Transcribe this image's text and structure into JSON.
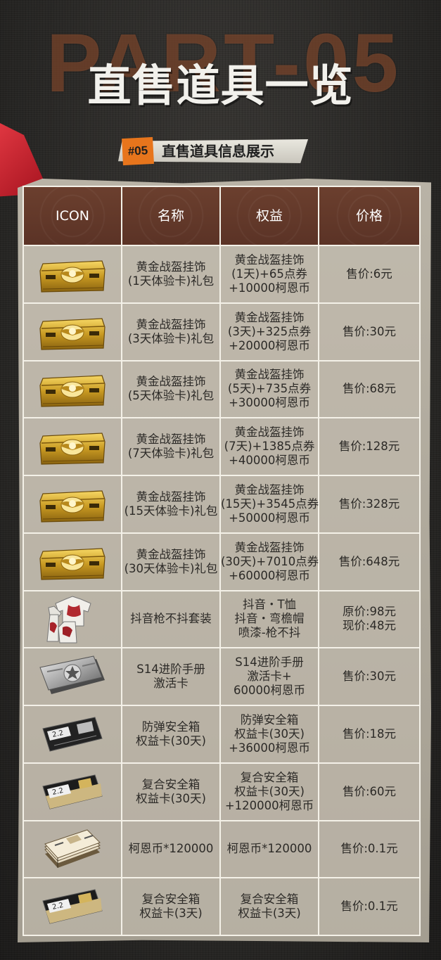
{
  "header": {
    "bg_text": "PART-05",
    "title": "直售道具一览",
    "tag": "#05",
    "subtitle": "直售道具信息展示"
  },
  "table": {
    "columns": [
      "ICON",
      "名称",
      "权益",
      "价格"
    ],
    "rows": [
      {
        "icon": "gold-crate-icon",
        "name": [
          "黄金战盔挂饰",
          "(1天体验卡)礼包"
        ],
        "benefit": [
          "黄金战盔挂饰",
          "(1天)+65点券",
          "+10000柯恩币"
        ],
        "price": [
          "售价:6元"
        ]
      },
      {
        "icon": "gold-crate-icon",
        "name": [
          "黄金战盔挂饰",
          "(3天体验卡)礼包"
        ],
        "benefit": [
          "黄金战盔挂饰",
          "(3天)+325点券",
          "+20000柯恩币"
        ],
        "price": [
          "售价:30元"
        ]
      },
      {
        "icon": "gold-crate-icon",
        "name": [
          "黄金战盔挂饰",
          "(5天体验卡)礼包"
        ],
        "benefit": [
          "黄金战盔挂饰",
          "(5天)+735点券",
          "+30000柯恩币"
        ],
        "price": [
          "售价:68元"
        ]
      },
      {
        "icon": "gold-crate-icon",
        "name": [
          "黄金战盔挂饰",
          "(7天体验卡)礼包"
        ],
        "benefit": [
          "黄金战盔挂饰",
          "(7天)+1385点券",
          "+40000柯恩币"
        ],
        "price": [
          "售价:128元"
        ]
      },
      {
        "icon": "gold-crate-icon",
        "name": [
          "黄金战盔挂饰",
          "(15天体验卡)礼包"
        ],
        "benefit": [
          "黄金战盔挂饰",
          "(15天)+3545点券",
          "+50000柯恩币"
        ],
        "price": [
          "售价:328元"
        ]
      },
      {
        "icon": "gold-crate-icon",
        "name": [
          "黄金战盔挂饰",
          "(30天体验卡)礼包"
        ],
        "benefit": [
          "黄金战盔挂饰",
          "(30天)+7010点券",
          "+60000柯恩币"
        ],
        "price": [
          "售价:648元"
        ]
      },
      {
        "icon": "tshirt-icon",
        "name": [
          "抖音枪不抖套装"
        ],
        "benefit": [
          "抖音・T恤",
          "抖音・弯檐帽",
          "喷漆-枪不抖"
        ],
        "price": [
          "原价:98元",
          "现价:48元"
        ]
      },
      {
        "icon": "silver-card-icon",
        "name": [
          "S14进阶手册",
          "激活卡"
        ],
        "benefit": [
          "S14进阶手册",
          "激活卡+",
          "60000柯恩币"
        ],
        "price": [
          "售价:30元"
        ]
      },
      {
        "icon": "black-card-icon",
        "name": [
          "防弹安全箱",
          "权益卡(30天)"
        ],
        "benefit": [
          "防弹安全箱",
          "权益卡(30天)",
          "+36000柯恩币"
        ],
        "price": [
          "售价:18元"
        ]
      },
      {
        "icon": "gold-black-card-icon",
        "name": [
          "复合安全箱",
          "权益卡(30天)"
        ],
        "benefit": [
          "复合安全箱",
          "权益卡(30天)",
          "+120000柯恩币"
        ],
        "price": [
          "售价:60元"
        ]
      },
      {
        "icon": "money-stack-icon",
        "name": [
          "柯恩币*120000"
        ],
        "benefit": [
          "柯恩币*120000"
        ],
        "price": [
          "售价:0.1元"
        ]
      },
      {
        "icon": "gold-black-card-icon",
        "name": [
          "复合安全箱",
          "权益卡(3天)"
        ],
        "benefit": [
          "复合安全箱",
          "权益卡(3天)"
        ],
        "price": [
          "售价:0.1元"
        ]
      }
    ]
  }
}
